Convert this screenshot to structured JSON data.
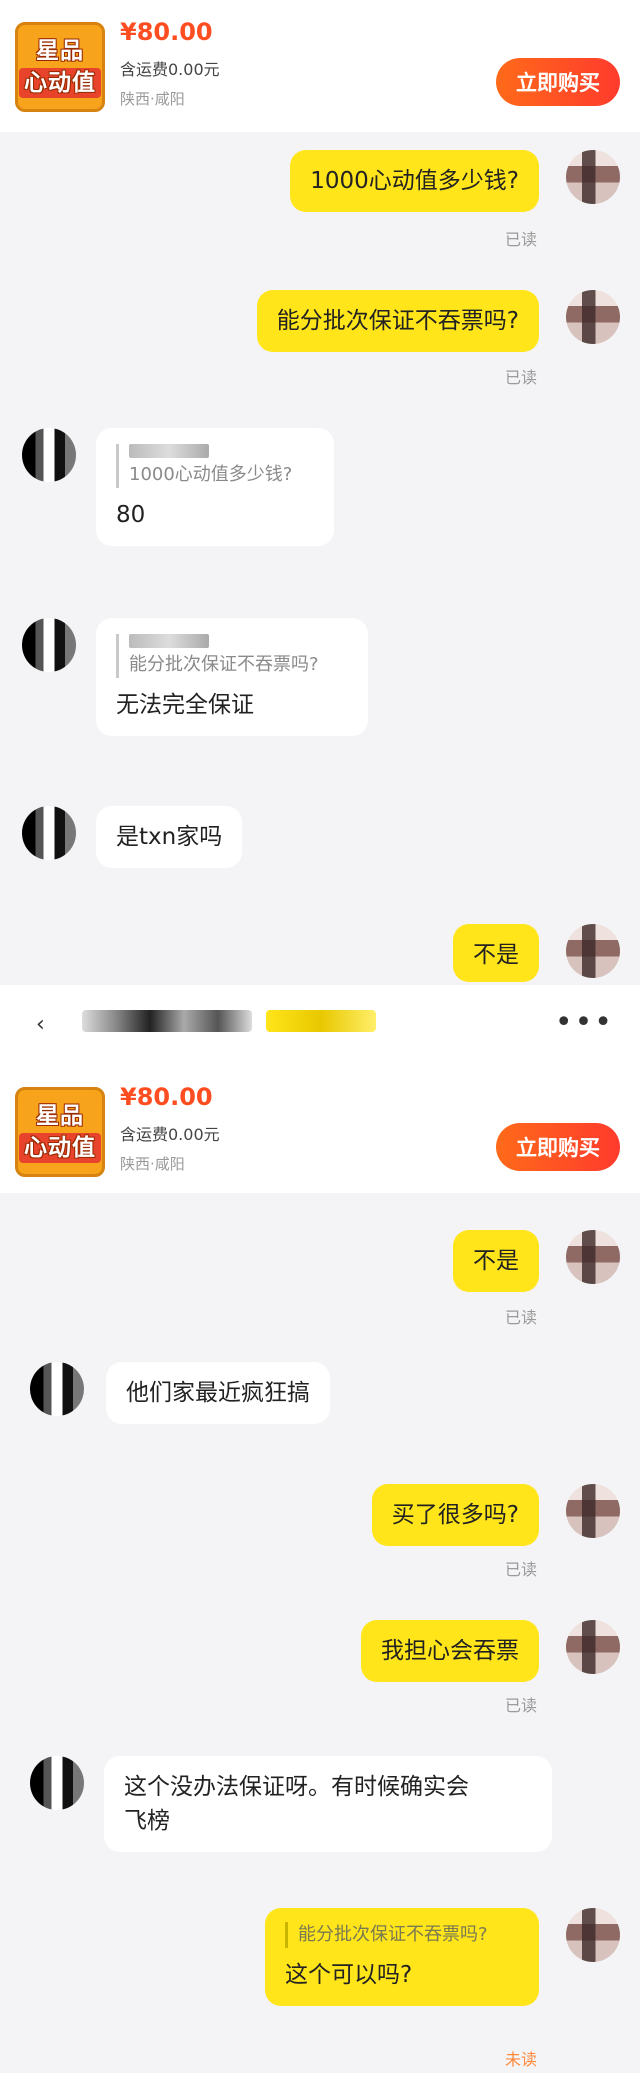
{
  "product": {
    "thumb_line1": "星品",
    "thumb_line2": "心动值",
    "price": "¥80.00",
    "shipping": "含运费0.00元",
    "location": "陕西·咸阳",
    "buy_label": "立即购买"
  },
  "chat1": {
    "msg1": "1000心动值多少钱?",
    "msg1_status": "已读",
    "msg2": "能分批次保证不吞票吗?",
    "msg2_status": "已读",
    "reply1_quote": "1000心动值多少钱?",
    "reply1": "80",
    "reply2_quote": "能分批次保证不吞票吗?",
    "reply2": "无法完全保证",
    "reply3": "是txn家吗",
    "msg3": "不是"
  },
  "chat2": {
    "msg1": "不是",
    "msg1_status": "已读",
    "reply1": "他们家最近疯狂搞",
    "msg2": "买了很多吗?",
    "msg2_status": "已读",
    "msg3": "我担心会吞票",
    "msg3_status": "已读",
    "reply2_line1": "这个没办法保证呀。有时候确实会",
    "reply2_line2": "飞榜",
    "msg4_quote": "能分批次保证不吞票吗?",
    "msg4": "这个可以吗?",
    "msg4_status": "未读"
  },
  "header2": {
    "more_icon": "•••"
  },
  "colors": {
    "my_bubble": "#ffe51a",
    "price": "#ff4d22",
    "buy_button": "#ff4b22",
    "unread": "#ff8a3a"
  }
}
